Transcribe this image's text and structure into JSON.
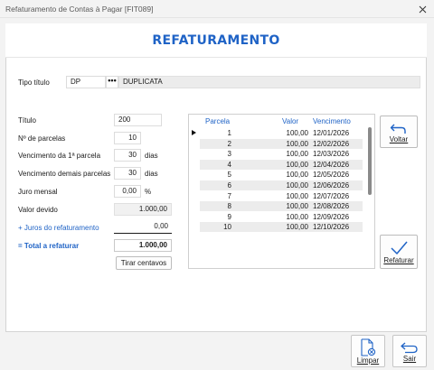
{
  "window": {
    "title": "Refaturamento de Contas à Pagar [FIT089]",
    "close_icon": "close-icon"
  },
  "header": {
    "title": "REFATURAMENTO"
  },
  "tipo_titulo": {
    "label": "Tipo título",
    "code": "DP",
    "lookup_label": "•••",
    "description": "DUPLICATA"
  },
  "form": {
    "titulo_label": "Título",
    "titulo_value": "200",
    "parcelas_label": "Nº de parcelas",
    "parcelas_value": "10",
    "venc_primeira_label": "Vencimento da 1ª parcela",
    "venc_primeira_value": "30",
    "venc_primeira_unit": "dias",
    "venc_demais_label": "Vencimento demais parcelas",
    "venc_demais_value": "30",
    "venc_demais_unit": "dias",
    "juro_label": "Juro mensal",
    "juro_value": "0,00",
    "juro_unit": "%",
    "valor_devido_label": "Valor devido",
    "valor_devido_value": "1.000,00",
    "juros_refat_label": "+ Juros do refaturamento",
    "juros_refat_value": "0,00",
    "total_label": "= Total a refaturar",
    "total_value": "1.000,00",
    "tirar_centavos_label": "Tirar centavos"
  },
  "grid": {
    "columns": [
      "Parcela",
      "Valor",
      "Vencimento"
    ],
    "rows": [
      [
        "1",
        "100,00",
        "12/01/2026"
      ],
      [
        "2",
        "100,00",
        "12/02/2026"
      ],
      [
        "3",
        "100,00",
        "12/03/2026"
      ],
      [
        "4",
        "100,00",
        "12/04/2026"
      ],
      [
        "5",
        "100,00",
        "12/05/2026"
      ],
      [
        "6",
        "100,00",
        "12/06/2026"
      ],
      [
        "7",
        "100,00",
        "12/07/2026"
      ],
      [
        "8",
        "100,00",
        "12/08/2026"
      ],
      [
        "9",
        "100,00",
        "12/09/2026"
      ],
      [
        "10",
        "100,00",
        "12/10/2026"
      ]
    ]
  },
  "actions": {
    "voltar_label": "Voltar",
    "refaturar_label": "Refaturar",
    "limpar_label": "Limpar",
    "sair_label": "Sair"
  },
  "colors": {
    "accent": "#1f63c6",
    "check": "#1f63c6",
    "row_alt": "#ececec"
  },
  "icons": {
    "voltar": "undo-arrow-icon",
    "refaturar": "checkmark-icon",
    "limpar": "clear-document-icon",
    "sair": "exit-arrow-icon"
  }
}
